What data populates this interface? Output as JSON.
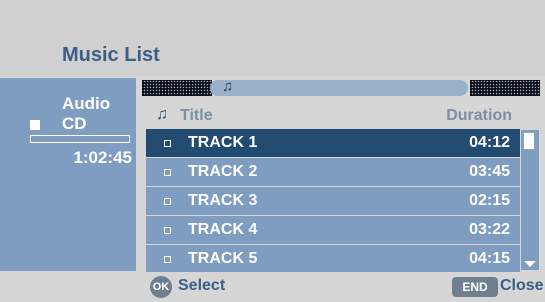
{
  "header": {
    "title": "Music List"
  },
  "source": {
    "label": "Audio CD",
    "total_time": "1:02:45",
    "progress": 0
  },
  "list": {
    "columns": {
      "title": "Title",
      "duration": "Duration"
    },
    "tracks": [
      {
        "name": "TRACK 1",
        "duration": "04:12"
      },
      {
        "name": "TRACK 2",
        "duration": "03:45"
      },
      {
        "name": "TRACK 3",
        "duration": "02:15"
      },
      {
        "name": "TRACK 4",
        "duration": "03:22"
      },
      {
        "name": "TRACK 5",
        "duration": "04:15"
      }
    ],
    "selected_index": 0
  },
  "footer": {
    "ok_key": "OK",
    "ok_label": "Select",
    "end_key": "END",
    "end_label": "Close"
  },
  "icons": {
    "note": "music-note-icon"
  },
  "colors": {
    "panel": "#7f9dc1",
    "selected": "#234a70",
    "title": "#3a5f86"
  }
}
